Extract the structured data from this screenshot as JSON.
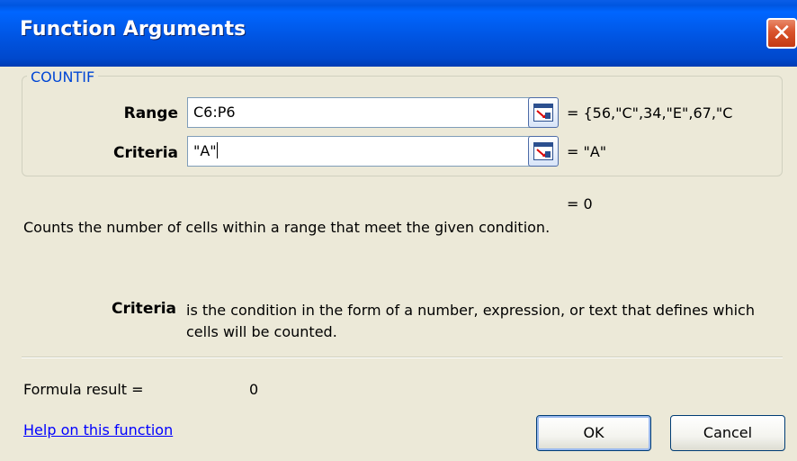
{
  "window": {
    "title": "Function Arguments"
  },
  "group": {
    "label": "COUNTIF"
  },
  "args": [
    {
      "label": "Range",
      "value": "C6:P6",
      "evaluated": "= {56,\"C\",34,\"E\",67,\"C"
    },
    {
      "label": "Criteria",
      "value": "\"A\"",
      "evaluated": "= \"A\""
    }
  ],
  "function_result": "= 0",
  "function_description": "Counts the number of cells within a range that meet the given condition.",
  "arg_help": {
    "name": "Criteria",
    "text": "is the condition in the form of a number, expression, or text that defines which cells will be counted."
  },
  "formula_result": {
    "label": "Formula result =",
    "value": "0"
  },
  "help_link": "Help on this function",
  "buttons": {
    "ok": "OK",
    "cancel": "Cancel"
  }
}
